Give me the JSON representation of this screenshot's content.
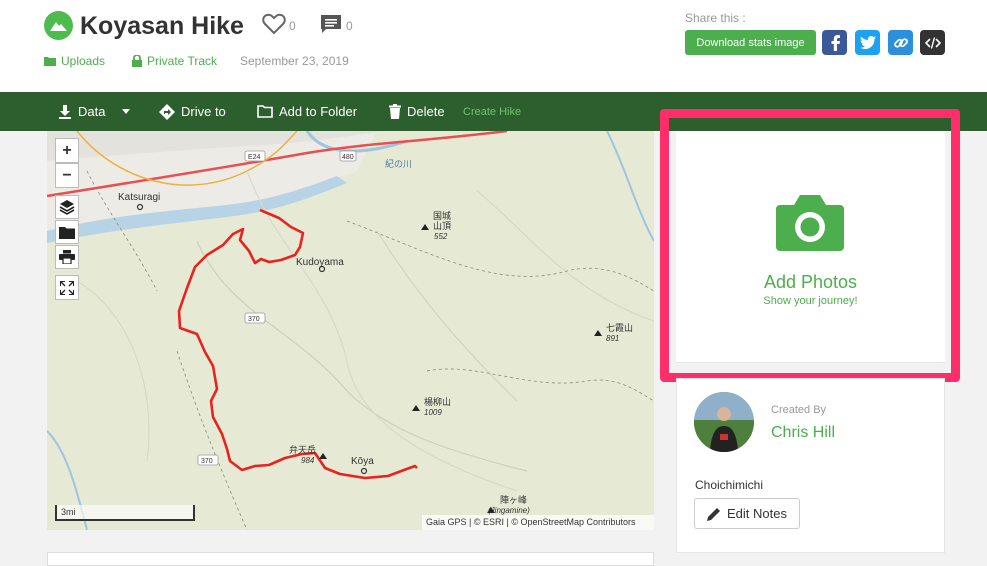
{
  "header": {
    "title": "Koyasan Hike",
    "likes": "0",
    "comments": "0",
    "meta": {
      "uploads": "Uploads",
      "privacy": "Private Track",
      "date": "September 23, 2019"
    },
    "share_label": "Share this :",
    "download_label": "Download stats image"
  },
  "toolbar": {
    "data_label": "Data",
    "drive_label": "Drive to",
    "folder_label": "Add to Folder",
    "delete_label": "Delete",
    "create_label": "Create Hike"
  },
  "map": {
    "zoom_in": "+",
    "zoom_out": "−",
    "scale_label": "3mi",
    "attribution": "Gaia GPS | © ESRI | © OpenStreetMap Contributors",
    "places": {
      "katsuragi": "Katsuragi",
      "kudoyama": "Kudoyama",
      "koya": "Kōya",
      "peak1_name_line1": "国城",
      "peak1_name_line2": "山頂",
      "peak1_elev": "552",
      "peak2_name": "七霞山",
      "peak2_elev": "891",
      "peak3_name": "楊柳山",
      "peak3_elev": "1009",
      "peak4_name": "弁天岳",
      "peak4_elev": "984",
      "peak5_name": "陣ヶ峰",
      "peak5_alt": "(Jingamine)",
      "river1": "紀の川",
      "road_e24": "E24",
      "road_370a": "370",
      "road_370b": "370",
      "road_480": "480"
    }
  },
  "photos": {
    "title": "Add Photos",
    "subtitle": "Show your journey!"
  },
  "creator": {
    "created_by_label": "Created By",
    "name": "Chris Hill",
    "notes": "Choichimichi",
    "edit_notes_label": "Edit Notes"
  },
  "colors": {
    "brand_green": "#4cae4c",
    "toolbar_green": "#2d5f2e",
    "highlight_pink": "#ff2e6a",
    "track_red": "#e8231f"
  },
  "icons": {
    "logo": "mountain-icon",
    "like": "heart-icon",
    "comment": "comment-icon",
    "facebook": "facebook-icon",
    "twitter": "twitter-icon",
    "link": "link-icon",
    "embed": "embed-icon",
    "download": "download-icon",
    "drive": "directions-icon",
    "folder": "folder-icon",
    "delete": "trash-icon",
    "camera": "camera-icon",
    "edit": "pencil-icon"
  }
}
